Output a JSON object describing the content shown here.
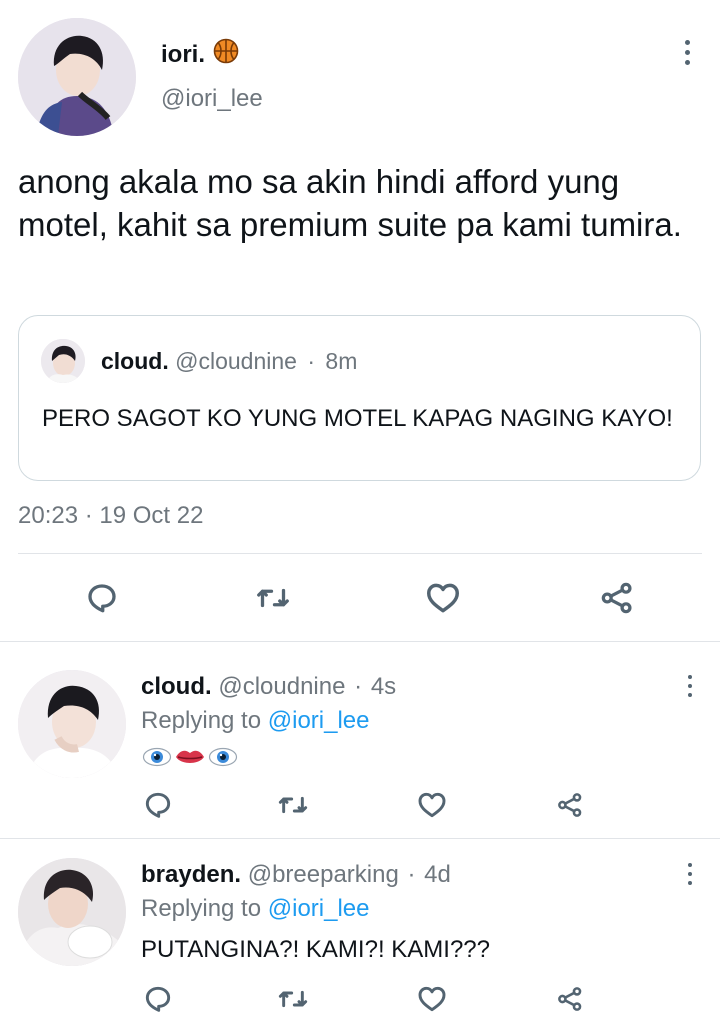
{
  "tweet": {
    "author_name": "iori.",
    "author_emoji_icon": "basketball-icon",
    "handle": "@iori_lee",
    "text": "anong akala mo sa akin hindi afford yung motel, kahit sa premium suite pa kami tumira.",
    "timestamp": "20:23 · 19 Oct 22",
    "quote": {
      "author_name": "cloud.",
      "handle": "@cloudnine",
      "separator": "·",
      "time": "8m",
      "text": "PERO SAGOT KO YUNG MOTEL KAPAG NAGING KAYO!"
    },
    "actions": [
      "reply-icon",
      "retweet-icon",
      "like-icon",
      "share-icon"
    ]
  },
  "replies": [
    {
      "author_name": "cloud.",
      "handle": "@cloudnine",
      "separator": "·",
      "time": "4s",
      "replying_prefix": "Replying to",
      "replying_to": "@iori_lee",
      "text_icons": [
        "eye-icon",
        "lips-icon",
        "eye-icon"
      ]
    },
    {
      "author_name": "brayden.",
      "handle": "@breeparking",
      "separator": "·",
      "time": "4d",
      "replying_prefix": "Replying to",
      "replying_to": "@iori_lee",
      "text": "PUTANGINA?! KAMI?! KAMI???"
    }
  ],
  "colors": {
    "link": "#1d9bf0",
    "muted": "#6e767d",
    "icon": "#536471",
    "divider": "#e1e4e8"
  }
}
